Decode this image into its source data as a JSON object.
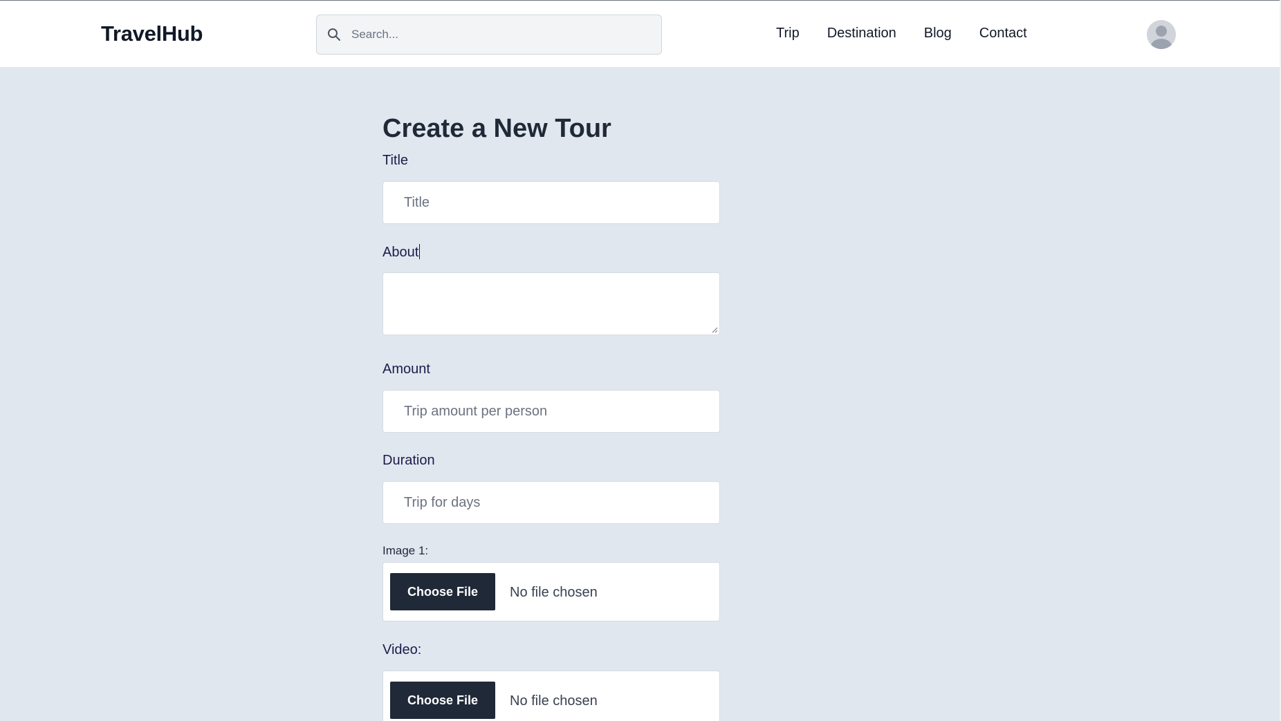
{
  "header": {
    "logo": "TravelHub",
    "search_placeholder": "Search...",
    "nav": [
      "Trip",
      "Destination",
      "Blog",
      "Contact"
    ]
  },
  "form": {
    "title": "Create a New Tour",
    "fields": {
      "title": {
        "label": "Title",
        "placeholder": "Title"
      },
      "about": {
        "label": "About"
      },
      "amount": {
        "label": "Amount",
        "placeholder": "Trip amount per person"
      },
      "duration": {
        "label": "Duration",
        "placeholder": "Trip for days"
      },
      "image1": {
        "label": "Image 1:",
        "button": "Choose File",
        "status": "No file chosen"
      },
      "video": {
        "label": "Video:",
        "button": "Choose File",
        "status": "No file chosen"
      }
    }
  },
  "colors": {
    "background": "#e1e7ef",
    "header": "#ffffff",
    "file_button": "#1f2937"
  }
}
